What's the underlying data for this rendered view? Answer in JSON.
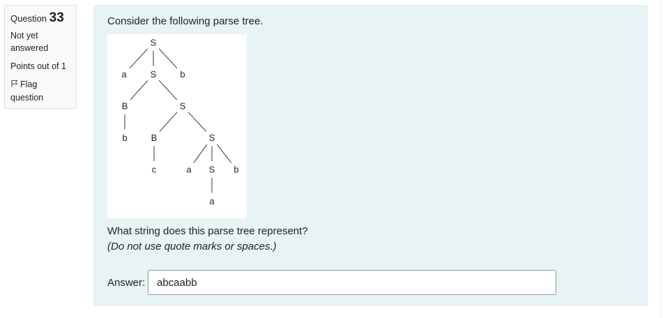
{
  "question_info": {
    "question_label": "Question",
    "question_number": "33",
    "state": "Not yet answered",
    "grade": "Points out of 1",
    "flag_label": "Flag question"
  },
  "question": {
    "text": "Consider the following parse tree.",
    "prompt": "What string does this parse tree represent?",
    "note": "(Do not use quote marks or spaces.)",
    "answer_label": "Answer:",
    "answer_value": "abcaabb"
  },
  "parse_tree": {
    "root": {
      "label": "S",
      "children": [
        {
          "label": "a",
          "children": []
        },
        {
          "label": "S",
          "children": [
            {
              "label": "B",
              "children": [
                {
                  "label": "b",
                  "children": []
                }
              ]
            },
            {
              "label": "S",
              "children": [
                {
                  "label": "B",
                  "children": [
                    {
                      "label": "c",
                      "children": []
                    }
                  ]
                },
                {
                  "label": "S",
                  "children": [
                    {
                      "label": "a",
                      "children": []
                    },
                    {
                      "label": "S",
                      "children": [
                        {
                          "label": "a",
                          "children": []
                        }
                      ]
                    },
                    {
                      "label": "b",
                      "children": []
                    }
                  ]
                }
              ]
            }
          ]
        },
        {
          "label": "b",
          "children": []
        }
      ]
    }
  }
}
